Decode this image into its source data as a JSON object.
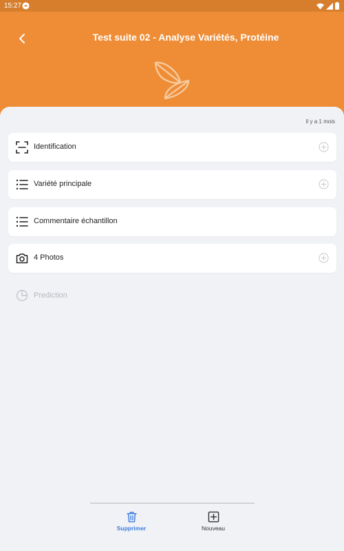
{
  "status_bar": {
    "time": "15:27"
  },
  "header": {
    "title": "Test suite 02 - Analyse Variétés, Protéine"
  },
  "timestamp": "Il y a 1 mois",
  "cards": [
    {
      "label": "Identification",
      "icon": "scan-icon",
      "has_plus": true
    },
    {
      "label": "Variété principale",
      "icon": "list-icon",
      "has_plus": true
    },
    {
      "label": "Commentaire échantillon",
      "icon": "list-icon",
      "has_plus": false
    },
    {
      "label": "4 Photos",
      "icon": "camera-icon",
      "has_plus": true
    }
  ],
  "prediction": {
    "label": "Prediction",
    "icon": "pie-chart-icon"
  },
  "bottom_bar": {
    "delete_label": "Supprimer",
    "new_label": "Nouveau"
  },
  "colors": {
    "accent": "#ef8d36",
    "status_bar": "#d77e2c",
    "background": "#f1f2f6",
    "delete_blue": "#3b7ddd"
  }
}
